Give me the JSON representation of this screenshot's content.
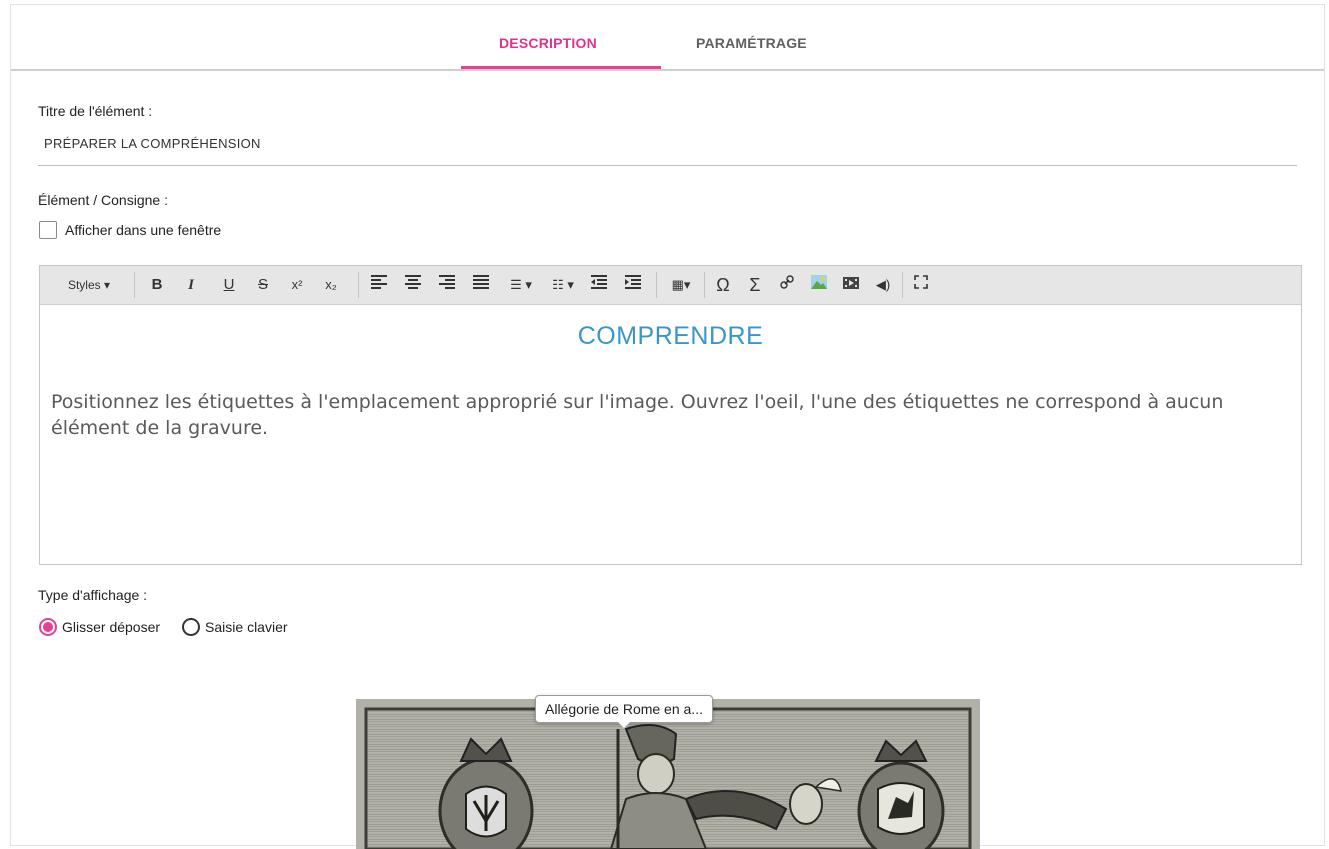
{
  "tabs": {
    "description": "DESCRIPTION",
    "parametrage": "PARAMÉTRAGE"
  },
  "form": {
    "title_label": "Titre de l'élément :",
    "title_value": "PRÉPARER LA COMPRÉHENSION",
    "instruction_label": "Élément / Consigne :",
    "window_checkbox_label": "Afficher dans une fenêtre",
    "window_checkbox_checked": false
  },
  "editor": {
    "toolbar": {
      "styles_label": "Styles ▾",
      "buttons": [
        "bold",
        "italic",
        "underline",
        "strikethrough",
        "superscript",
        "subscript",
        "align-left",
        "align-center",
        "align-right",
        "justify",
        "bulleted-list",
        "numbered-list",
        "outdent",
        "indent",
        "table",
        "special-char",
        "sigma",
        "link",
        "image",
        "video",
        "audio",
        "fullscreen"
      ]
    },
    "heading": "COMPRENDRE",
    "body": "Positionnez les étiquettes à l'emplacement approprié sur l'image. Ouvrez l'oeil, l'une des étiquettes ne correspond à aucun élément de la gravure."
  },
  "display": {
    "label": "Type d'affichage :",
    "options": [
      "Glisser déposer",
      "Saisie clavier"
    ],
    "selected": "Glisser déposer"
  },
  "image": {
    "tooltip": "Allégorie de Rome en a..."
  },
  "colors": {
    "accent": "#e83e96",
    "heading": "#3a95c9"
  }
}
